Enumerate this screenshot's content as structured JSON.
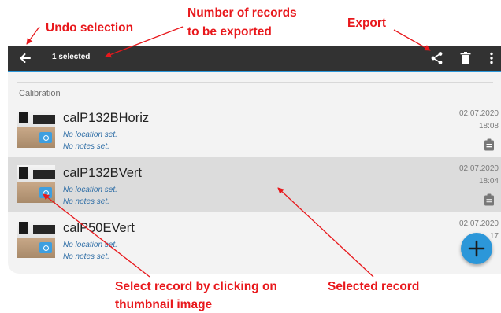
{
  "annotations": {
    "undo_selection": "Undo selection",
    "records_count_line1": "Number of records",
    "records_count_line2": "to be exported",
    "export": "Export",
    "select_thumbnail_line1": "Select record by clicking on",
    "select_thumbnail_line2": "thumbnail image",
    "selected_record": "Selected record"
  },
  "colors": {
    "annotation": "#e8181c",
    "topbar": "#323232",
    "accent": "#2c97d9",
    "selected_row": "#dcdcdc"
  },
  "toolbar": {
    "back_icon": "arrow-left-icon",
    "selected_count": "1 selected",
    "share_icon": "share-icon",
    "delete_icon": "trash-icon",
    "more_icon": "more-vertical-icon"
  },
  "list": {
    "section": "Calibration",
    "records": [
      {
        "title": "calP132BHoriz",
        "location": "No location set.",
        "notes": "No notes set.",
        "date": "02.07.2020",
        "time": "18:08",
        "selected": false
      },
      {
        "title": "calP132BVert",
        "location": "No location set.",
        "notes": "No notes set.",
        "date": "02.07.2020",
        "time": "18:04",
        "selected": true
      },
      {
        "title": "calP50EVert",
        "location": "No location set.",
        "notes": "No notes set.",
        "date": "02.07.2020",
        "time": "17",
        "selected": false
      }
    ]
  },
  "fab": {
    "icon": "plus-icon"
  }
}
